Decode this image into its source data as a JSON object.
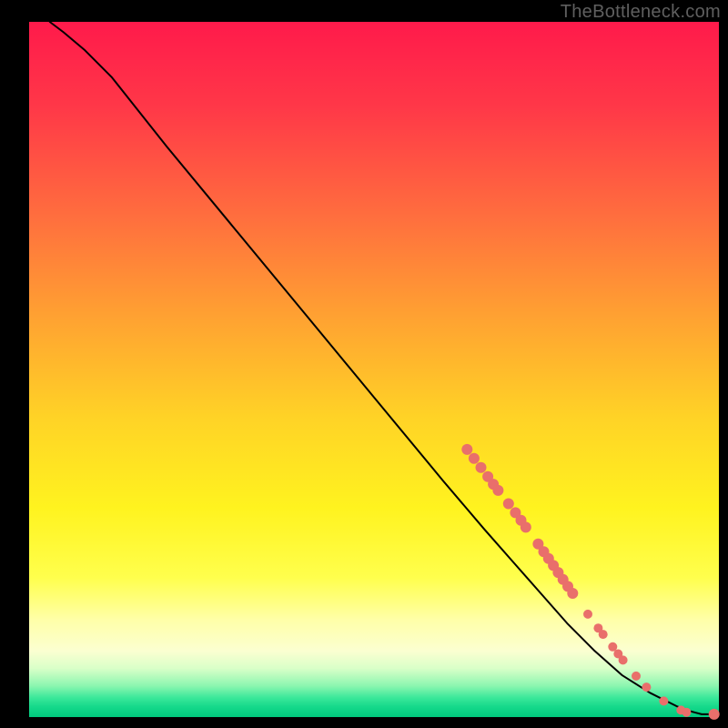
{
  "watermark": "TheBottleneck.com",
  "chart_data": {
    "type": "line",
    "title": "",
    "xlabel": "",
    "ylabel": "",
    "xlim": [
      0,
      100
    ],
    "ylim": [
      0,
      100
    ],
    "grid": false,
    "legend": false,
    "background_gradient": {
      "stops": [
        {
          "offset": 0.0,
          "color": "#ff1a4b"
        },
        {
          "offset": 0.12,
          "color": "#ff3748"
        },
        {
          "offset": 0.28,
          "color": "#ff6e3e"
        },
        {
          "offset": 0.42,
          "color": "#ffa032"
        },
        {
          "offset": 0.57,
          "color": "#ffd326"
        },
        {
          "offset": 0.7,
          "color": "#fff31f"
        },
        {
          "offset": 0.8,
          "color": "#ffff4d"
        },
        {
          "offset": 0.86,
          "color": "#ffffa8"
        },
        {
          "offset": 0.905,
          "color": "#fbffd1"
        },
        {
          "offset": 0.93,
          "color": "#d9ffc8"
        },
        {
          "offset": 0.955,
          "color": "#8cf6b0"
        },
        {
          "offset": 0.972,
          "color": "#3be89a"
        },
        {
          "offset": 0.985,
          "color": "#16d98b"
        },
        {
          "offset": 1.0,
          "color": "#00c97d"
        }
      ]
    },
    "series": [
      {
        "name": "bottleneck-curve",
        "color": "#000000",
        "x": [
          3,
          5,
          8,
          12,
          20,
          30,
          40,
          50,
          60,
          66,
          70,
          74,
          78,
          82,
          86,
          90,
          94,
          96,
          97.5,
          100
        ],
        "y": [
          100,
          98.5,
          96,
          92,
          82,
          70,
          58,
          46,
          34,
          27,
          22.5,
          18,
          13.5,
          9.5,
          6,
          3.5,
          1.5,
          0.8,
          0.4,
          0.4
        ]
      }
    ],
    "scatter": {
      "name": "highlighted-points",
      "color": "#e96f6b",
      "points": [
        {
          "x": 63.5,
          "y": 38.5,
          "r": 6
        },
        {
          "x": 64.5,
          "y": 37.2,
          "r": 6
        },
        {
          "x": 65.5,
          "y": 35.9,
          "r": 6
        },
        {
          "x": 66.5,
          "y": 34.6,
          "r": 6
        },
        {
          "x": 67.3,
          "y": 33.5,
          "r": 6
        },
        {
          "x": 68.0,
          "y": 32.6,
          "r": 6
        },
        {
          "x": 69.5,
          "y": 30.7,
          "r": 6
        },
        {
          "x": 70.5,
          "y": 29.4,
          "r": 6
        },
        {
          "x": 71.3,
          "y": 28.3,
          "r": 6
        },
        {
          "x": 72.0,
          "y": 27.3,
          "r": 6
        },
        {
          "x": 73.8,
          "y": 24.9,
          "r": 6
        },
        {
          "x": 74.6,
          "y": 23.8,
          "r": 6
        },
        {
          "x": 75.3,
          "y": 22.8,
          "r": 6
        },
        {
          "x": 76.0,
          "y": 21.8,
          "r": 6
        },
        {
          "x": 76.7,
          "y": 20.8,
          "r": 6
        },
        {
          "x": 77.4,
          "y": 19.8,
          "r": 6
        },
        {
          "x": 78.1,
          "y": 18.8,
          "r": 6
        },
        {
          "x": 78.8,
          "y": 17.8,
          "r": 6
        },
        {
          "x": 81.0,
          "y": 14.8,
          "r": 5
        },
        {
          "x": 82.5,
          "y": 12.8,
          "r": 5
        },
        {
          "x": 83.2,
          "y": 11.9,
          "r": 5
        },
        {
          "x": 84.6,
          "y": 10.1,
          "r": 5
        },
        {
          "x": 85.4,
          "y": 9.1,
          "r": 5
        },
        {
          "x": 86.1,
          "y": 8.2,
          "r": 5
        },
        {
          "x": 88.0,
          "y": 5.9,
          "r": 5
        },
        {
          "x": 89.5,
          "y": 4.3,
          "r": 5
        },
        {
          "x": 92.0,
          "y": 2.3,
          "r": 5
        },
        {
          "x": 94.5,
          "y": 1.0,
          "r": 5
        },
        {
          "x": 95.3,
          "y": 0.7,
          "r": 5
        },
        {
          "x": 99.3,
          "y": 0.4,
          "r": 6
        }
      ]
    }
  }
}
